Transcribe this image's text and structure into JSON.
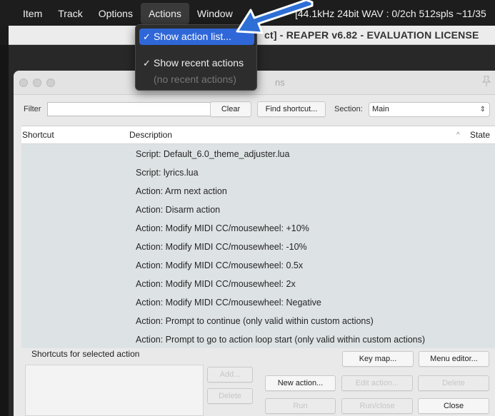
{
  "menubar": {
    "items": [
      {
        "label": "Item"
      },
      {
        "label": "Track"
      },
      {
        "label": "Options"
      },
      {
        "label": "Actions"
      },
      {
        "label": "Window"
      }
    ],
    "status": "[44.1kHz 24bit WAV : 0/2ch 512spls ~11/35"
  },
  "window_title": "ct] - REAPER v6.82 - EVALUATION LICENSE",
  "actions_menu": {
    "items": [
      {
        "label": "Show action list...",
        "checked": true
      },
      {
        "label": "Show recent actions",
        "checked": true
      },
      {
        "label": "(no recent actions)",
        "disabled": true
      }
    ],
    "check_glyph": "✓"
  },
  "dialog": {
    "title_fragment": "ns",
    "filter_label": "Filter",
    "filter_value": "",
    "clear_label": "Clear",
    "find_shortcut_label": "Find shortcut...",
    "section_label": "Section:",
    "section_value": "Main",
    "columns": {
      "shortcut": "Shortcut",
      "description": "Description",
      "state": "State"
    },
    "rows": [
      "Script: Default_6.0_theme_adjuster.lua",
      "Script: lyrics.lua",
      "Action: Arm next action",
      "Action: Disarm action",
      "Action: Modify MIDI CC/mousewheel: +10%",
      "Action: Modify MIDI CC/mousewheel: -10%",
      "Action: Modify MIDI CC/mousewheel: 0.5x",
      "Action: Modify MIDI CC/mousewheel: 2x",
      "Action: Modify MIDI CC/mousewheel: Negative",
      "Action: Prompt to continue (only valid within custom actions)",
      "Action: Prompt to go to action loop start (only valid within custom actions)"
    ],
    "shortcuts_label": "Shortcuts for selected action",
    "buttons": {
      "add": "Add...",
      "delete_shortcut": "Delete",
      "key_map": "Key map...",
      "menu_editor": "Menu editor...",
      "new_action": "New action...",
      "edit_action": "Edit action...",
      "delete_action": "Delete",
      "run": "Run",
      "run_close": "Run/close",
      "close": "Close"
    }
  },
  "icons": {
    "sort": "chevron-up-icon",
    "section_select": "updown-chevron-icon",
    "pin": "pin-icon",
    "annotation": "arrow-icon"
  },
  "colors": {
    "menu_highlight": "#2f67d8",
    "annotation_arrow": "#2e6fd6"
  }
}
